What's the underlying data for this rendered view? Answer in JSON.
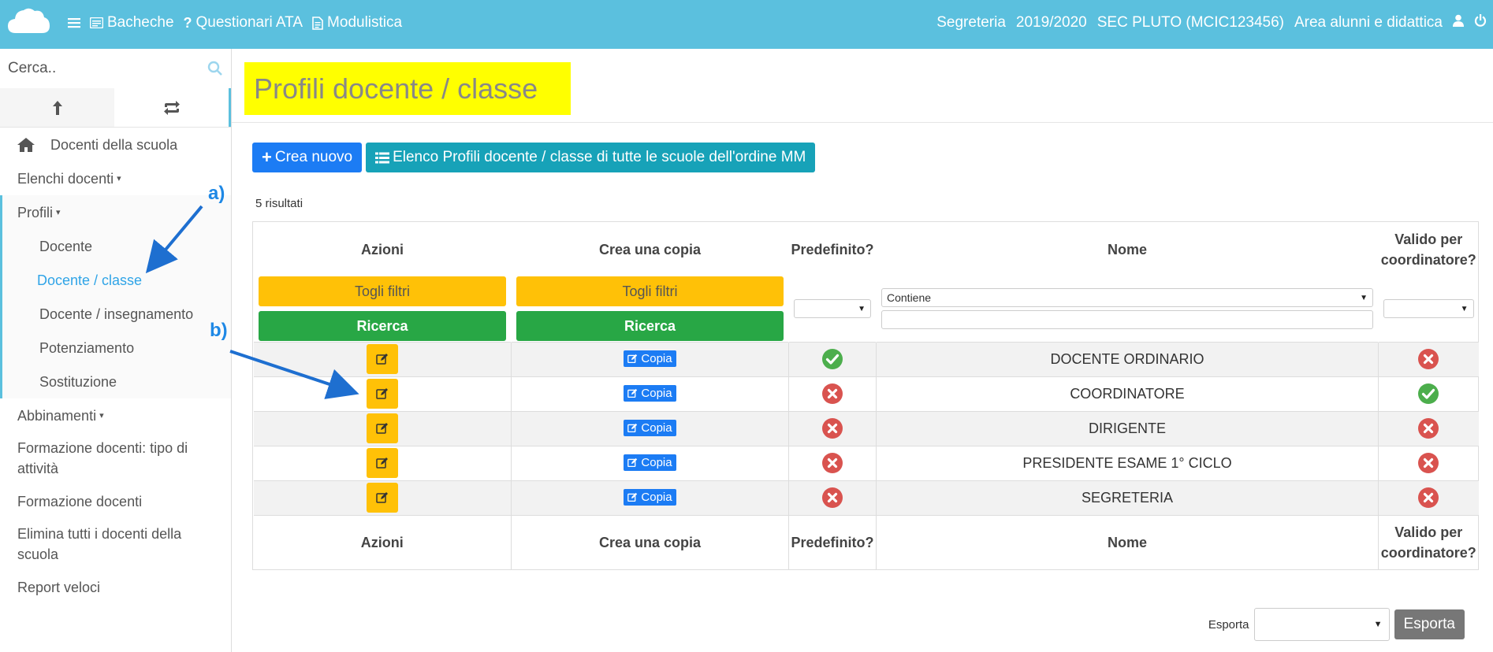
{
  "topbar": {
    "logo_icon": "cloud-icon",
    "menu": [
      {
        "icon": "list-icon",
        "label": ""
      },
      {
        "icon": "board-icon",
        "label": "Bacheche"
      },
      {
        "icon": "question-icon",
        "label": "Questionari ATA"
      },
      {
        "icon": "document-icon",
        "label": "Modulistica"
      }
    ],
    "right": {
      "role": "Segreteria",
      "year": "2019/2020",
      "school": "SEC PLUTO (MCIC123456)",
      "area": "Area alunni e didattica",
      "user_icon": "user-icon",
      "power_icon": "power-icon"
    }
  },
  "sidebar": {
    "search_placeholder": "Cerca..",
    "tabs": [
      {
        "icon": "arrow-up-icon"
      },
      {
        "icon": "refresh-icon"
      }
    ],
    "items": [
      {
        "label": "Docenti della scuola",
        "icon": "home-icon"
      },
      {
        "label": "Elenchi docenti"
      },
      {
        "label": "Profili"
      },
      {
        "label": "Docente"
      },
      {
        "label": "Docente / classe"
      },
      {
        "label": "Docente / insegnamento"
      },
      {
        "label": "Potenziamento"
      },
      {
        "label": "Sostituzione"
      },
      {
        "label": "Abbinamenti"
      },
      {
        "label": "Formazione docenti: tipo di attività"
      },
      {
        "label": "Formazione docenti"
      },
      {
        "label": "Elimina tutti i docenti della scuola"
      },
      {
        "label": "Report veloci"
      }
    ]
  },
  "main": {
    "title": "Profili docente / classe",
    "buttons": {
      "create": "Crea nuovo",
      "list": "Elenco Profili docente / classe di tutte le scuole dell'ordine MM"
    },
    "results": "5 risultati",
    "columns": {
      "actions": "Azioni",
      "copy": "Crea una copia",
      "default": "Predefinito?",
      "name": "Nome",
      "valid_1": "Valido per",
      "valid_2": "coordinatore?"
    },
    "filters": {
      "clear": "Togli filtri",
      "search": "Ricerca",
      "name_mode": "Contiene"
    },
    "copy_label": "Copia",
    "rows": [
      {
        "name": "DOCENTE ORDINARIO",
        "default": true,
        "valid": false
      },
      {
        "name": "COORDINATORE",
        "default": false,
        "valid": true
      },
      {
        "name": "DIRIGENTE",
        "default": false,
        "valid": false
      },
      {
        "name": "PRESIDENTE ESAME 1° CICLO",
        "default": false,
        "valid": false
      },
      {
        "name": "SEGRETERIA",
        "default": false,
        "valid": false
      }
    ],
    "export": {
      "label": "Esporta",
      "button": "Esporta"
    }
  },
  "annotations": {
    "a": "a)",
    "b": "b)"
  },
  "colors": {
    "topbar": "#5bc0de",
    "primary": "#1c7cf4",
    "info": "#17a2b8",
    "warning": "#ffc107",
    "success": "#28a745",
    "danger": "#dc3545",
    "title_highlight": "#ffff00"
  }
}
